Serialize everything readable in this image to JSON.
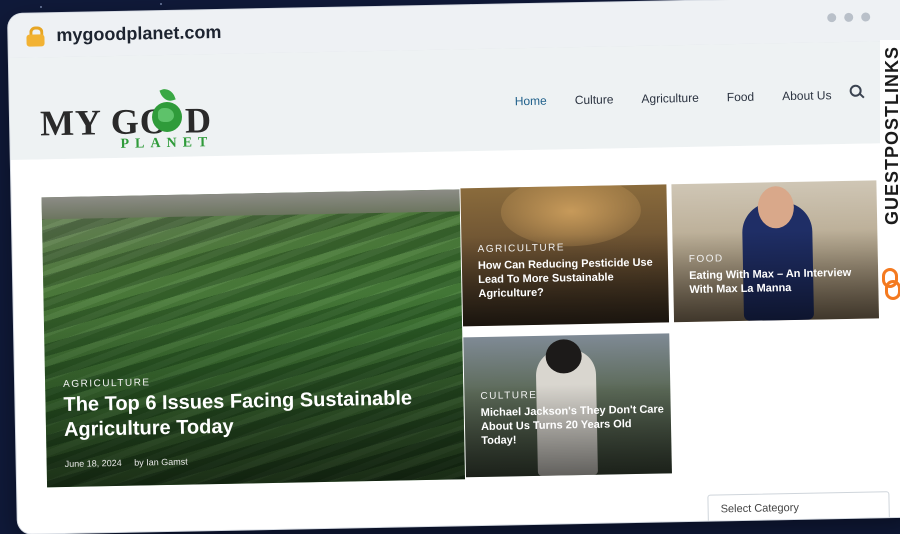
{
  "browser": {
    "url": "mygoodplanet.com"
  },
  "site": {
    "logo_top_left": "MY GO",
    "logo_top_right": "D",
    "logo_bottom": "PLANET",
    "nav": [
      {
        "label": "Home"
      },
      {
        "label": "Culture"
      },
      {
        "label": "Agriculture"
      },
      {
        "label": "Food"
      },
      {
        "label": "About Us"
      }
    ]
  },
  "featured": {
    "category": "AGRICULTURE",
    "title": "The Top 6 Issues Facing Sustainable Agriculture Today",
    "date": "June 18, 2024",
    "author": "by Ian Gamst"
  },
  "cards": [
    {
      "category": "AGRICULTURE",
      "title": "How Can Reducing Pesticide Use Lead To More Sustainable Agriculture?"
    },
    {
      "category": "FOOD",
      "title": "Eating With Max – An Interview With Max La Manna"
    },
    {
      "category": "CULTURE",
      "title": "Michael Jackson's They Don't Care About Us Turns 20 Years Old Today!"
    }
  ],
  "sidebar": {
    "select_placeholder": "Select Category"
  },
  "watermark": {
    "text": "GUESTPOSTLINKS"
  },
  "colors": {
    "nav_active": "#1e5f8a",
    "logo_green": "#2f9b3a",
    "watermark_accent": "#f47a20"
  }
}
